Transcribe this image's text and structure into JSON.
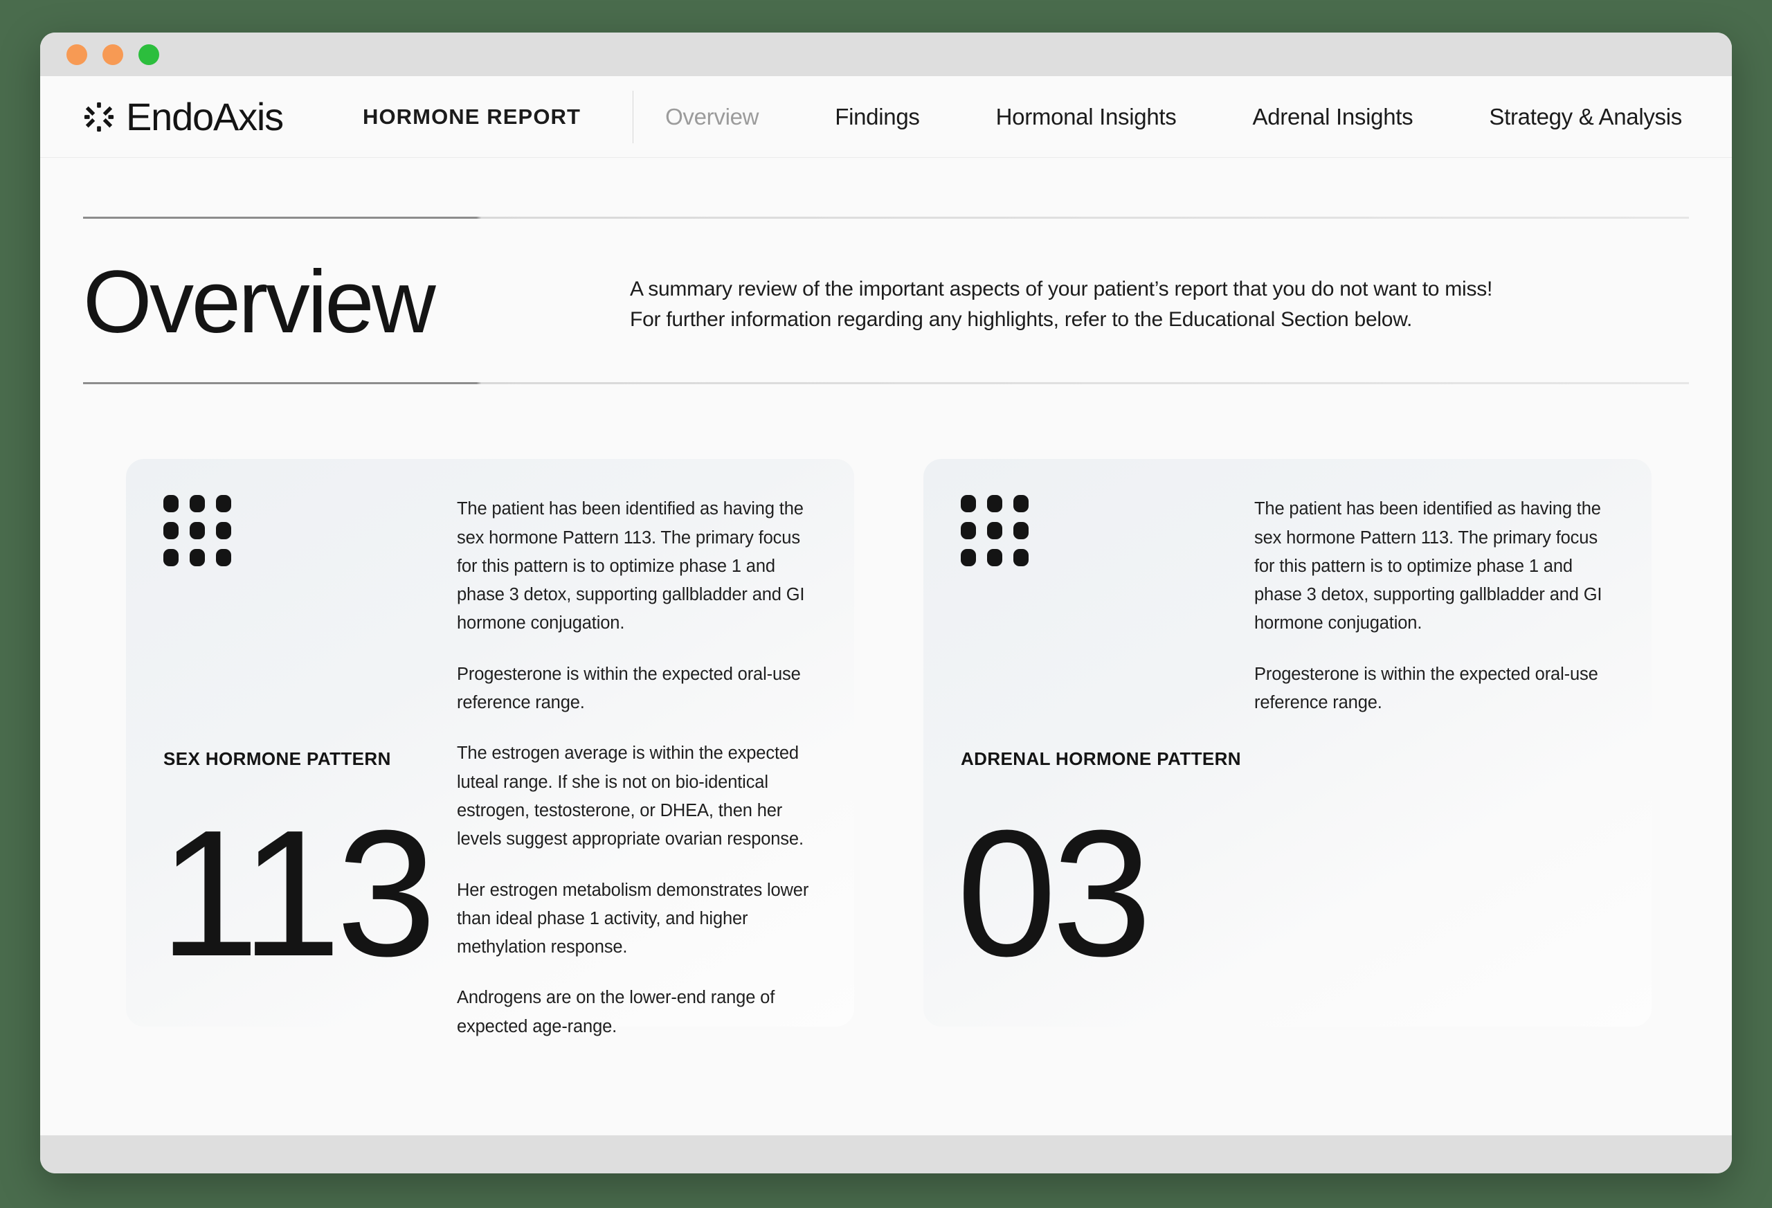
{
  "window": {
    "traffic_lights": [
      "close",
      "minimize",
      "maximize"
    ]
  },
  "header": {
    "brand_name": "EndoAxis",
    "brand_icon": "endoaxis-starburst-logo",
    "report_title": "HORMONE REPORT",
    "nav": [
      {
        "label": "Overview",
        "active": true
      },
      {
        "label": "Findings",
        "active": false
      },
      {
        "label": "Hormonal Insights",
        "active": false
      },
      {
        "label": "Adrenal Insights",
        "active": false
      },
      {
        "label": "Strategy & Analysis",
        "active": false
      }
    ]
  },
  "page": {
    "title": "Overview",
    "subtitle_line1": "A summary review of the important aspects of your patient’s report that you do not want to miss!",
    "subtitle_line2": "For further information regarding any highlights, refer to the Educational Section below."
  },
  "cards": [
    {
      "icon": "dot-grid-icon",
      "label": "SEX HORMONE PATTERN",
      "number": "113",
      "paragraphs": [
        "The patient has been identified as having the sex hormone Pattern 113. The primary focus for this pattern is to optimize phase 1 and phase 3 detox, supporting gallbladder and GI hormone conjugation.",
        "Progesterone is within the expected oral-use reference range.",
        "The estrogen average is within the expected luteal range. If she is not on bio-identical estrogen, testosterone, or DHEA, then her levels suggest appropriate ovarian response.",
        "Her estrogen metabolism demonstrates lower than ideal phase 1 activity, and higher methylation response.",
        "Androgens are on the lower-end range of expected age-range."
      ]
    },
    {
      "icon": "dot-grid-icon",
      "label": "ADRENAL HORMONE PATTERN",
      "number": "03",
      "paragraphs": [
        "The patient has been identified as having the sex hormone Pattern 113. The primary focus for this pattern is to optimize phase 1 and phase 3 detox, supporting gallbladder and GI hormone conjugation.",
        "Progesterone is within the expected oral-use reference range."
      ]
    }
  ],
  "colors": {
    "page_background": "#4a6c4d",
    "window_chrome": "#dedede",
    "canvas": "#fafafa",
    "text_primary": "#141414",
    "nav_active": "#9b9b9b",
    "traffic_orange": "#f79a54",
    "traffic_green": "#2cbe3d"
  }
}
